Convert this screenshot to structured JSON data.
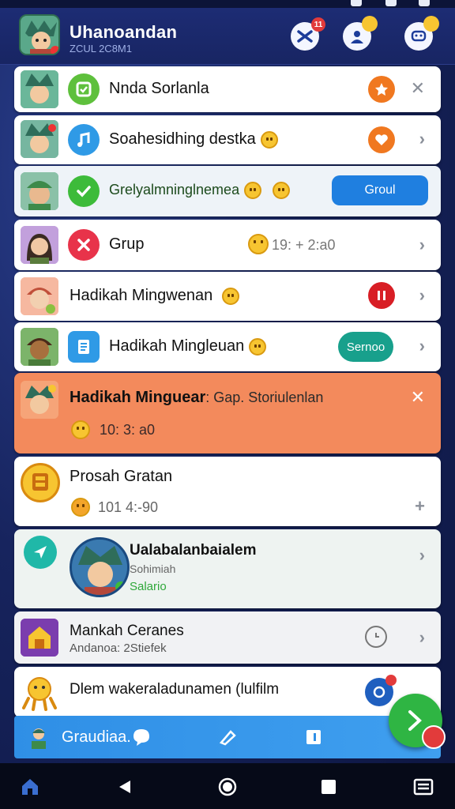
{
  "header": {
    "title": "Uhanoandan",
    "subtitle": "ZCUL 2C8M1",
    "badges": [
      "11",
      "",
      ""
    ]
  },
  "rows": [
    {
      "title": "Nnda Sorlanla",
      "icon": "check-square-icon",
      "trailing": "star-icon"
    },
    {
      "title": "Soahesidhing destka",
      "icon": "music-note-icon",
      "trailing": "heart-icon"
    },
    {
      "title": "Grelyalmninglnemea",
      "icon": "checkmark-icon",
      "button": "Groul"
    },
    {
      "title": "Grup",
      "icon": "cross-icon",
      "time": "19: + 2:a0"
    },
    {
      "title": "Hadikah Mingwenan",
      "trailing": "pause-icon"
    },
    {
      "title": "Hadikah Mingleuan",
      "icon": "document-icon",
      "button": "Sernoo"
    },
    {
      "title": "Hadikah Minguear",
      "subtitle": ": Gap. Storiulenlan",
      "time": "10: 3: a0"
    },
    {
      "title": "Prosah Gratan",
      "time": "101 4:-90"
    },
    {
      "title": "Ualabalanbaialem",
      "line2": "Sohimiah",
      "line3": "Salario"
    },
    {
      "title": "Mankah Ceranes",
      "subtitle": "Andanoa: 2Stiefek"
    },
    {
      "title": "Dlem wakeraladunamen (lulfilm"
    }
  ],
  "bottom_bar": {
    "label": "Graudiaa."
  },
  "colors": {
    "header_bg": "#1a2868",
    "highlight_row": "#f38a5c",
    "accent_blue": "#2f8fe6",
    "fab_green": "#2fb543",
    "orange": "#f07820"
  }
}
